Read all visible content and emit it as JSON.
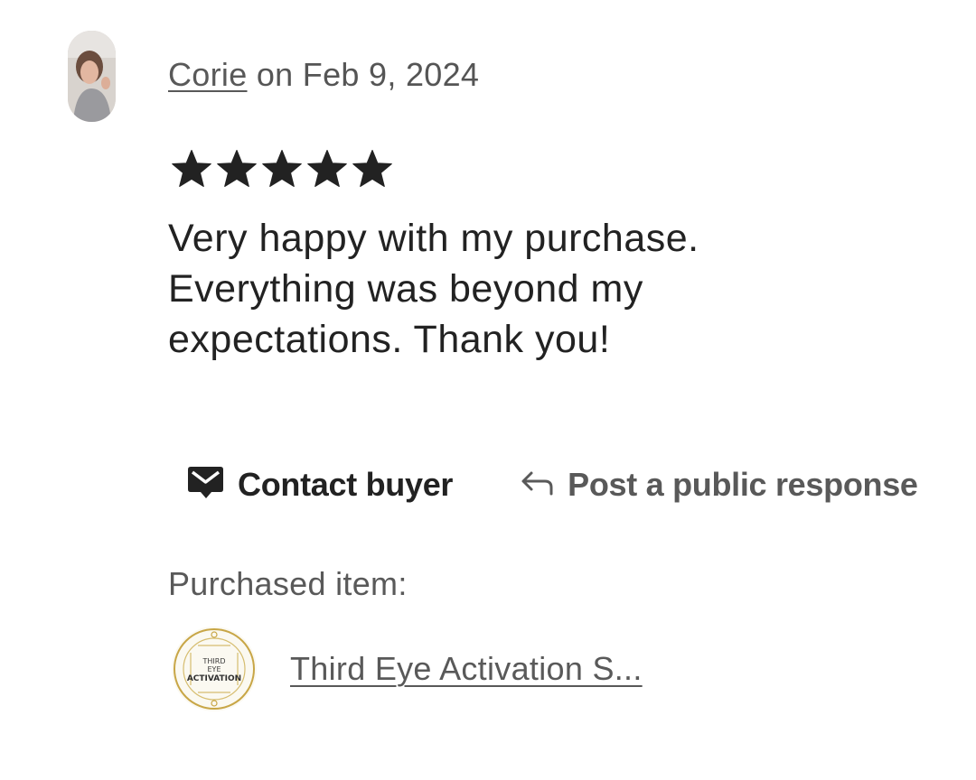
{
  "review": {
    "buyer_name": "Corie",
    "date_text": "on Feb 9, 2024",
    "rating": 5,
    "max_rating": 5,
    "text": "Very happy with my purchase. Everything was beyond my expectations. Thank you!"
  },
  "actions": {
    "contact_label": "Contact buyer",
    "respond_label": "Post a public response"
  },
  "purchase": {
    "label": "Purchased item:",
    "item_title": "Third Eye Activation S...",
    "thumb_text": [
      "THIRD",
      "EYE",
      "ACTIVATION"
    ]
  },
  "colors": {
    "text_primary": "#222222",
    "text_secondary": "#595959",
    "accent_gold": "#c8a646"
  },
  "icons": {
    "stars": "star-icon",
    "contact": "mail-icon",
    "respond": "reply-arrow-icon"
  }
}
